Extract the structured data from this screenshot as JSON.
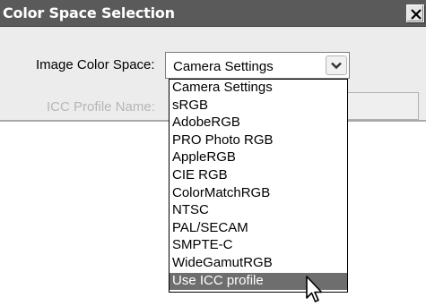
{
  "dialog": {
    "title": "Color Space Selection",
    "close_icon": "close-icon"
  },
  "form": {
    "image_color_space_label": "Image Color Space:",
    "icc_profile_label": "ICC Profile Name:",
    "icc_profile_value": ""
  },
  "select": {
    "value": "Camera Settings",
    "arrow_icon": "chevron-down-icon"
  },
  "dropdown": {
    "options": [
      "Camera Settings",
      "sRGB",
      "AdobeRGB",
      "PRO Photo RGB",
      "AppleRGB",
      "CIE RGB",
      "ColorMatchRGB",
      "NTSC",
      "PAL/SECAM",
      "SMPTE-C",
      "WideGamutRGB",
      "Use ICC profile"
    ],
    "highlighted_index": 11
  },
  "colors": {
    "titlebar": "#5a5a5a",
    "highlight": "#6e6e6e",
    "dialog_bg": "#ececec"
  }
}
